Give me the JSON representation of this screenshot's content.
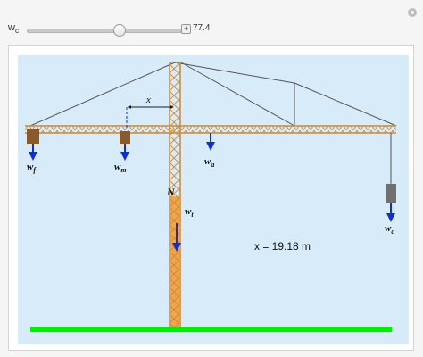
{
  "control": {
    "label_main": "w",
    "label_sub": "c",
    "value": "77.4",
    "slider_fraction": 0.6,
    "plus_symbol": "+"
  },
  "scene": {
    "labels": {
      "wf_main": "w",
      "wf_sub": "f",
      "wm_main": "w",
      "wm_sub": "m",
      "wa_main": "w",
      "wa_sub": "a",
      "wt_main": "w",
      "wt_sub": "t",
      "wc_main": "w",
      "wc_sub": "c",
      "normal": "N",
      "x_dim": "x",
      "x_readout": "x = 19.18 m"
    },
    "colors": {
      "sky": "#d7ebf9",
      "lattice": "#c98a3a",
      "tower_load": "#f1a44a",
      "weight_block": "#8b5a2b",
      "counter_block": "#707070",
      "arrow": "#1030c8",
      "ground": "#00ee00",
      "cable": "#555555"
    }
  }
}
